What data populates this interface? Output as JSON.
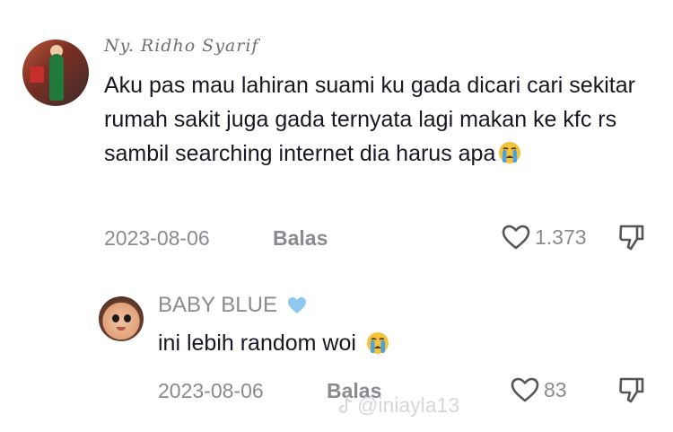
{
  "comments": [
    {
      "username": "Ny. Ridho Syarif",
      "text": "Aku pas mau lahiran suami ku gada dicari cari sekitar rumah sakit juga gada ternyata lagi makan ke kfc rs sambil searching internet dia harus apa",
      "emoji": "loudly-crying-face",
      "date": "2023-08-06",
      "reply_label": "Balas",
      "likes": "1.373"
    }
  ],
  "replies": [
    {
      "username": "BABY BLUE",
      "badge": "blue-heart",
      "text": "ini lebih random woi",
      "emoji": "loudly-crying-face",
      "date": "2023-08-06",
      "reply_label": "Balas",
      "likes": "83"
    }
  ],
  "watermark": "@iniayla13",
  "colors": {
    "text": "#161823",
    "meta": "#8a8b91",
    "badge_blue": "#8ec8ef",
    "emoji_yellow": "#f5c33b",
    "emoji_tear": "#4aa3df"
  }
}
